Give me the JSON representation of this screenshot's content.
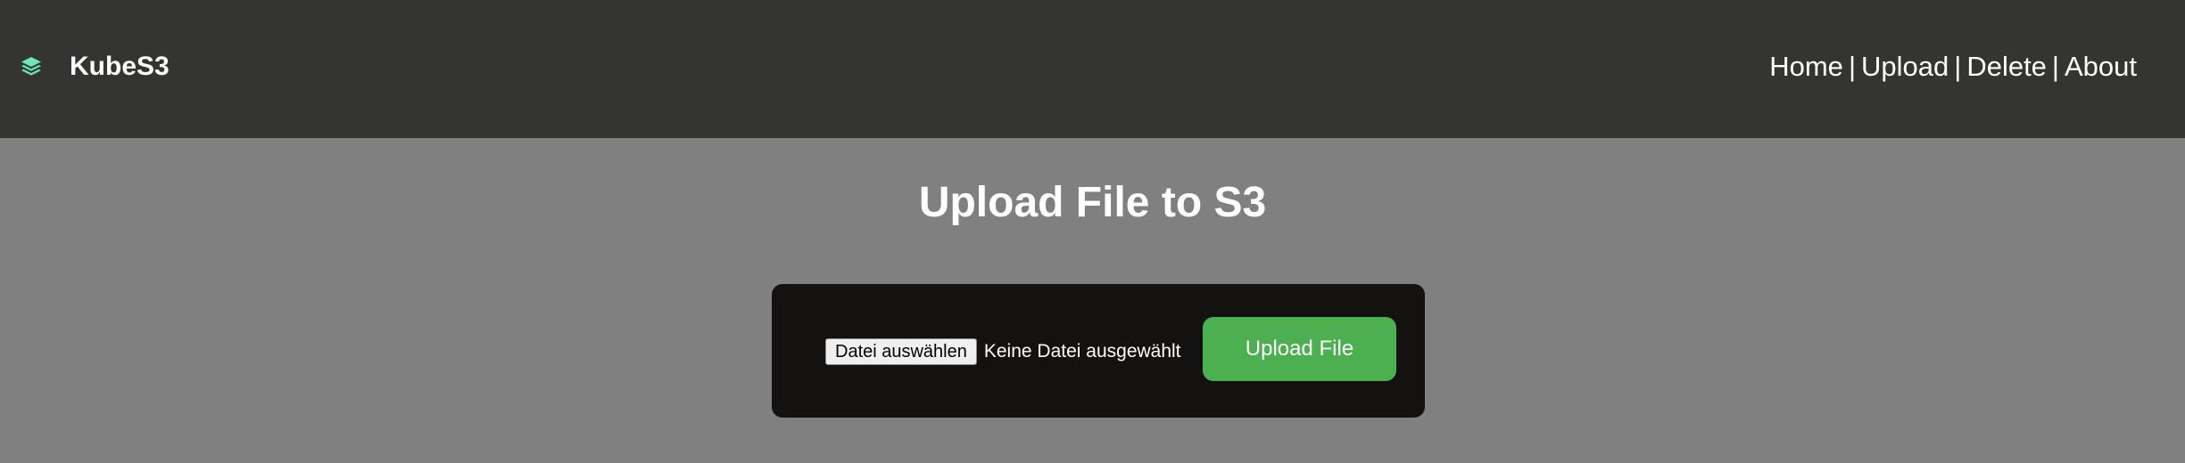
{
  "header": {
    "brand_name": "KubeS3",
    "brand_icon": "layers-icon",
    "nav": [
      {
        "label": "Home"
      },
      {
        "label": "Upload"
      },
      {
        "label": "Delete"
      },
      {
        "label": "About"
      }
    ],
    "separator": "|"
  },
  "main": {
    "title": "Upload File to S3",
    "file_input": {
      "choose_label": "Datei auswählen",
      "status_text": "Keine Datei ausgewählt"
    },
    "upload_button_label": "Upload File"
  },
  "colors": {
    "header_bg": "#343433",
    "page_bg": "#808080",
    "card_bg": "#141111",
    "accent_green": "#4caf50",
    "icon_teal": "#6ee7b7"
  }
}
